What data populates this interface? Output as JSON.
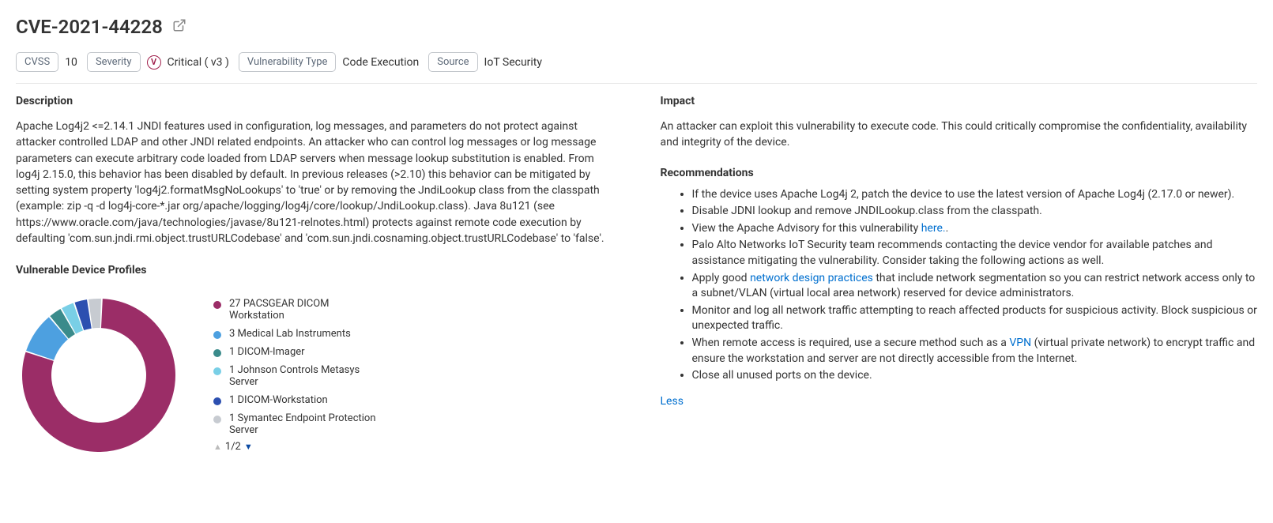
{
  "header": {
    "title": "CVE-2021-44228"
  },
  "badges": {
    "cvss_label": "CVSS",
    "cvss_value": "10",
    "severity_label": "Severity",
    "severity_value": "Critical ( v3 )",
    "vuln_type_label": "Vulnerability Type",
    "vuln_type_value": "Code Execution",
    "source_label": "Source",
    "source_value": "IoT Security",
    "sev_icon_letter": "V"
  },
  "description": {
    "heading": "Description",
    "text": "Apache Log4j2 <=2.14.1 JNDI features used in configuration, log messages, and parameters do not protect against attacker controlled LDAP and other JNDI related endpoints. An attacker who can control log messages or log message parameters can execute arbitrary code loaded from LDAP servers when message lookup substitution is enabled. From log4j 2.15.0, this behavior has been disabled by default. In previous releases (>2.10) this behavior can be mitigated by setting system property 'log4j2.formatMsgNoLookups' to 'true' or by removing the JndiLookup class from the classpath (example: zip -q -d log4j-core-*.jar org/apache/logging/log4j/core/lookup/JndiLookup.class). Java 8u121 (see https://www.oracle.com/java/technologies/javase/8u121-relnotes.html) protects against remote code execution by defaulting 'com.sun.jndi.rmi.object.trustURLCodebase' and 'com.sun.jndi.cosnaming.object.trustURLCodebase' to 'false'."
  },
  "profiles": {
    "heading": "Vulnerable Device Profiles",
    "legend": [
      {
        "count": 27,
        "label": "27 PACSGEAR DICOM Workstation",
        "color": "#9b2d67"
      },
      {
        "count": 3,
        "label": "3 Medical Lab Instruments",
        "color": "#4da0e0"
      },
      {
        "count": 1,
        "label": "1 DICOM-Imager",
        "color": "#3a8b8b"
      },
      {
        "count": 1,
        "label": "1 Johnson Controls Metasys Server",
        "color": "#79cfe6"
      },
      {
        "count": 1,
        "label": "1 DICOM-Workstation",
        "color": "#2c4fb0"
      },
      {
        "count": 1,
        "label": "1 Symantec Endpoint Protection Server",
        "color": "#c7cbd1"
      }
    ],
    "pager": "1/2"
  },
  "impact": {
    "heading": "Impact",
    "text": "An attacker can exploit this vulnerability to execute code. This could critically compromise the confidentiality, availability and integrity of the device."
  },
  "rec": {
    "heading": "Recommendations",
    "items": {
      "r0": "If the device uses Apache Log4j 2, patch the device to use the latest version of Apache Log4j (2.17.0 or newer).",
      "r1": "Disable JDNI lookup and remove JNDILookup.class from the classpath.",
      "r2a": "View the Apache Advisory for this vulnerability ",
      "r2link": "here.",
      "r2b": ".",
      "r3": "Palo Alto Networks IoT Security team recommends contacting the device vendor for available patches and assistance mitigating the vulnerability. Consider taking the following actions as well.",
      "r4a": "Apply good ",
      "r4link": "network design practices",
      "r4b": " that include network segmentation so you can restrict network access only to a subnet/VLAN (virtual local area network) reserved for device administrators.",
      "r5": "Monitor and log all network traffic attempting to reach affected products for suspicious activity. Block suspicious or unexpected traffic.",
      "r6a": "When remote access is required, use a secure method such as a ",
      "r6link": "VPN",
      "r6b": " (virtual private network) to encrypt traffic and ensure the workstation and server are not directly accessible from the Internet.",
      "r7": "Close all unused ports on the device."
    },
    "less": "Less"
  },
  "chart_data": {
    "type": "pie",
    "title": "Vulnerable Device Profiles",
    "categories": [
      "PACSGEAR DICOM Workstation",
      "Medical Lab Instruments",
      "DICOM-Imager",
      "Johnson Controls Metasys Server",
      "DICOM-Workstation",
      "Symantec Endpoint Protection Server"
    ],
    "values": [
      27,
      3,
      1,
      1,
      1,
      1
    ],
    "colors": [
      "#9b2d67",
      "#4da0e0",
      "#3a8b8b",
      "#79cfe6",
      "#2c4fb0",
      "#c7cbd1"
    ]
  }
}
